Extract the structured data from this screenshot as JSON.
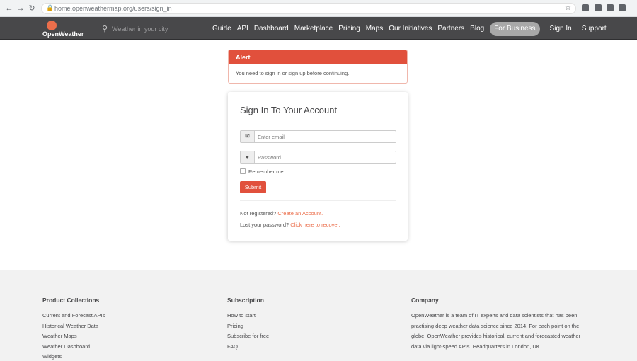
{
  "browser": {
    "url": "home.openweathermap.org/users/sign_in"
  },
  "nav": {
    "brand": "OpenWeather",
    "search_placeholder": "Weather in your city",
    "items": [
      "Guide",
      "API",
      "Dashboard",
      "Marketplace",
      "Pricing",
      "Maps",
      "Our Initiatives",
      "Partners",
      "Blog"
    ],
    "for_business": "For Business",
    "sign_in": "Sign In",
    "support": "Support"
  },
  "alert": {
    "title": "Alert",
    "message": "You need to sign in or sign up before continuing."
  },
  "login": {
    "title": "Sign In To Your Account",
    "email_placeholder": "Enter email",
    "password_placeholder": "Password",
    "remember_label": "Remember me",
    "submit_label": "Submit",
    "not_registered": "Not registered?",
    "create_account": "Create an Account.",
    "lost_password": "Lost your password?",
    "reset_link": "Click here to recover."
  },
  "footer": {
    "product": {
      "heading": "Product Collections",
      "links": [
        "Current and Forecast APIs",
        "Historical Weather Data",
        "Weather Maps",
        "Weather Dashboard",
        "Widgets"
      ]
    },
    "subscription": {
      "heading": "Subscription",
      "links": [
        "How to start",
        "Pricing",
        "Subscribe for free",
        "FAQ"
      ]
    },
    "company": {
      "heading": "Company",
      "text": "OpenWeather is a team of IT experts and data scientists that has been practising deep weather data science since 2014. For each point on the globe, OpenWeather provides historical, current and forecasted weather data via light-speed APIs. Headquarters in London, UK."
    }
  },
  "colors": {
    "brand": "#eb6e4b",
    "nav_bg": "#48484a",
    "alert_red": "#e1503c",
    "footer_bg": "#f2f2f2"
  }
}
